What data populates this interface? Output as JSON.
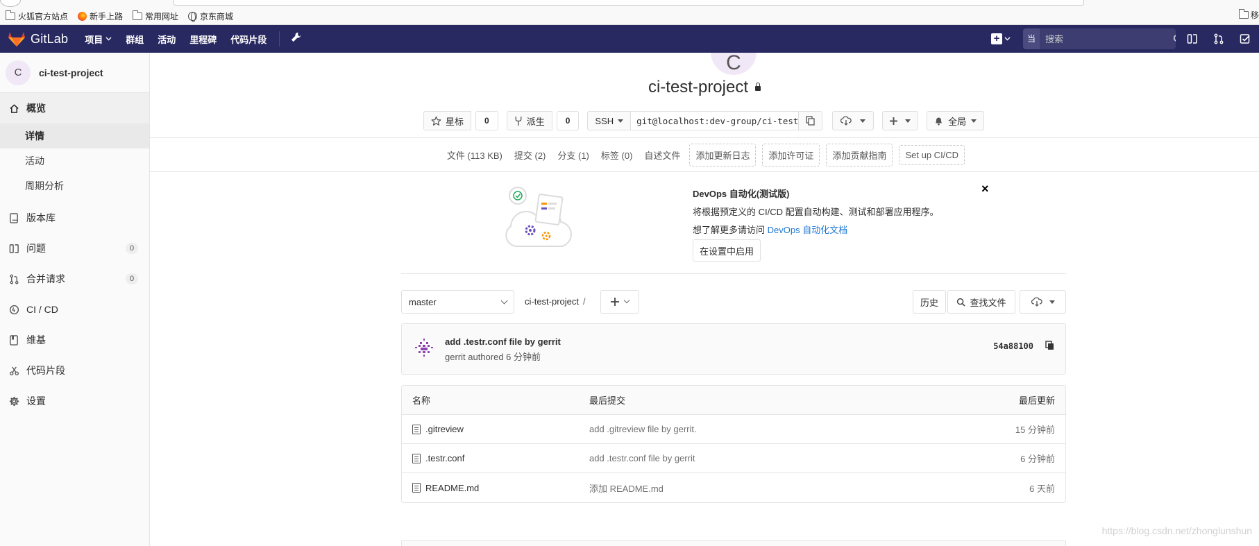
{
  "bookmarks": {
    "items": [
      {
        "label": "火狐官方站点",
        "icon": "folder-icon"
      },
      {
        "label": "新手上路",
        "icon": "firefox-icon"
      },
      {
        "label": "常用网址",
        "icon": "folder-icon"
      },
      {
        "label": "京东商城",
        "icon": "globe-icon"
      }
    ],
    "right_label": "移"
  },
  "nav": {
    "brand": "GitLab",
    "links": [
      {
        "label": "项目",
        "has_caret": true
      },
      {
        "label": "群组"
      },
      {
        "label": "活动"
      },
      {
        "label": "里程碑"
      },
      {
        "label": "代码片段"
      }
    ],
    "search_scope": "当前项目",
    "search_placeholder": "搜索",
    "accent_color": "#292961"
  },
  "sidebar": {
    "project_initial": "C",
    "project_name": "ci-test-project",
    "overview_label": "概览",
    "sub_items": [
      {
        "label": "详情",
        "active": true
      },
      {
        "label": "活动"
      },
      {
        "label": "周期分析"
      }
    ],
    "items": [
      {
        "label": "版本库",
        "icon": "book-icon"
      },
      {
        "label": "问题",
        "icon": "issues-icon",
        "badge": "0"
      },
      {
        "label": "合并请求",
        "icon": "merge-request-icon",
        "badge": "0"
      },
      {
        "label": "CI / CD",
        "icon": "rocket-icon"
      },
      {
        "label": "维基",
        "icon": "wiki-icon"
      },
      {
        "label": "代码片段",
        "icon": "scissors-icon"
      },
      {
        "label": "设置",
        "icon": "gear-icon"
      }
    ]
  },
  "project": {
    "avatar_initial": "C",
    "title": "ci-test-project",
    "star_label": "星标",
    "star_count": "0",
    "fork_label": "派生",
    "fork_count": "0",
    "clone_protocol": "SSH",
    "clone_url": "git@localhost:dev-group/ci-test-project.git",
    "notify_label": "全局"
  },
  "stats": {
    "files": "文件 (113 KB)",
    "commits": "提交 (2)",
    "branches": "分支 (1)",
    "tags": "标签 (0)",
    "readme": "自述文件",
    "add_changelog": "添加更新日志",
    "add_license": "添加许可证",
    "add_contributing": "添加贡献指南",
    "setup_ci": "Set up CI/CD"
  },
  "auto_devops": {
    "title": "DevOps 自动化(测试版)",
    "text1": "将根据预定义的 CI/CD 配置自动构建、测试和部署应用程序。",
    "text2_prefix": "想了解更多请访问 ",
    "link": "DevOps 自动化文档",
    "button": "在设置中启用",
    "close": "×"
  },
  "tree": {
    "branch": "master",
    "path": "ci-test-project",
    "path_sep": "/",
    "history_label": "历史",
    "find_file_label": "查找文件"
  },
  "last_commit": {
    "title": "add .testr.conf file by gerrit",
    "meta": "gerrit authored 6 分钟前",
    "sha": "54a88100"
  },
  "files": {
    "headers": {
      "name": "名称",
      "last_commit": "最后提交",
      "last_update": "最后更新"
    },
    "rows": [
      {
        "name": ".gitreview",
        "commit": "add .gitreview file by gerrit.",
        "updated": "15 分钟前"
      },
      {
        "name": ".testr.conf",
        "commit": "add .testr.conf file by gerrit",
        "updated": "6 分钟前"
      },
      {
        "name": "README.md",
        "commit": "添加 README.md",
        "updated": "6 天前"
      }
    ]
  },
  "watermark": "https://blog.csdn.net/zhonglunshun"
}
